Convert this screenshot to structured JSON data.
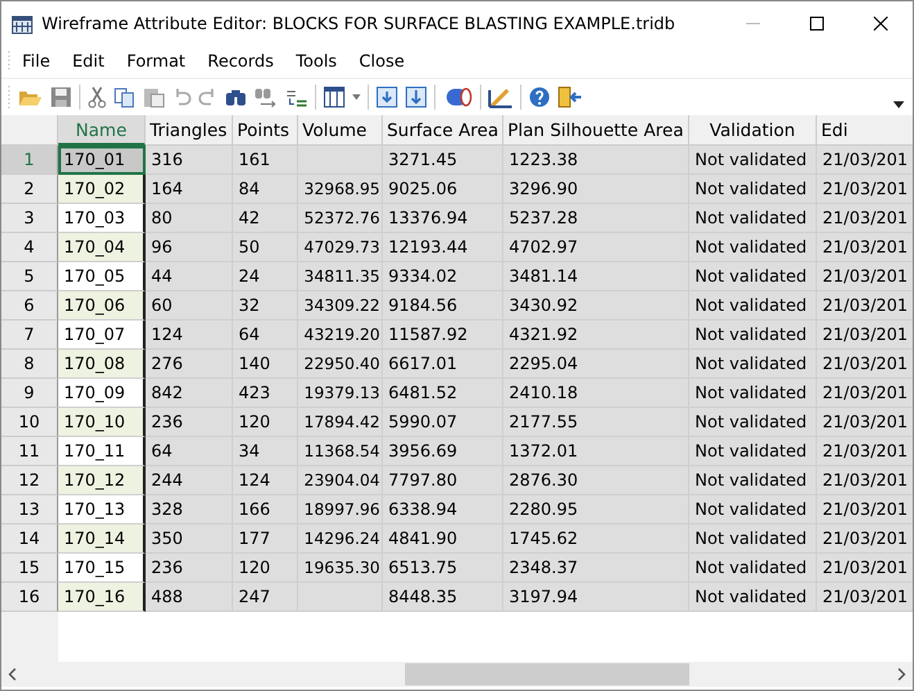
{
  "window": {
    "title": "Wireframe Attribute Editor: BLOCKS FOR SURFACE BLASTING EXAMPLE.tridb"
  },
  "menu": [
    "File",
    "Edit",
    "Format",
    "Records",
    "Tools",
    "Close"
  ],
  "table": {
    "columns": [
      {
        "label": "Name",
        "selected": true
      },
      {
        "label": "Triangles",
        "selected": false
      },
      {
        "label": "Points",
        "selected": false
      },
      {
        "label": "Volume",
        "selected": false
      },
      {
        "label": "Surface Area",
        "selected": false
      },
      {
        "label": "Plan Silhouette Area",
        "selected": false
      },
      {
        "label": "Validation",
        "selected": false
      },
      {
        "label": "Edi",
        "selected": false
      }
    ],
    "rows": [
      {
        "number": "1",
        "selected": true,
        "cells": [
          "170_01",
          "316",
          "161",
          "",
          "3271.45",
          "1223.38",
          "Not validated",
          "21/03/201"
        ]
      },
      {
        "number": "2",
        "selected": false,
        "cells": [
          "170_02",
          "164",
          "84",
          "32968.95",
          "9025.06",
          "3296.90",
          "Not validated",
          "21/03/201"
        ]
      },
      {
        "number": "3",
        "selected": false,
        "cells": [
          "170_03",
          "80",
          "42",
          "52372.76",
          "13376.94",
          "5237.28",
          "Not validated",
          "21/03/201"
        ]
      },
      {
        "number": "4",
        "selected": false,
        "cells": [
          "170_04",
          "96",
          "50",
          "47029.73",
          "12193.44",
          "4702.97",
          "Not validated",
          "21/03/201"
        ]
      },
      {
        "number": "5",
        "selected": false,
        "cells": [
          "170_05",
          "44",
          "24",
          "34811.35",
          "9334.02",
          "3481.14",
          "Not validated",
          "21/03/201"
        ]
      },
      {
        "number": "6",
        "selected": false,
        "cells": [
          "170_06",
          "60",
          "32",
          "34309.22",
          "9184.56",
          "3430.92",
          "Not validated",
          "21/03/201"
        ]
      },
      {
        "number": "7",
        "selected": false,
        "cells": [
          "170_07",
          "124",
          "64",
          "43219.20",
          "11587.92",
          "4321.92",
          "Not validated",
          "21/03/201"
        ]
      },
      {
        "number": "8",
        "selected": false,
        "cells": [
          "170_08",
          "276",
          "140",
          "22950.40",
          "6617.01",
          "2295.04",
          "Not validated",
          "21/03/201"
        ]
      },
      {
        "number": "9",
        "selected": false,
        "cells": [
          "170_09",
          "842",
          "423",
          "19379.13",
          "6481.52",
          "2410.18",
          "Not validated",
          "21/03/201"
        ]
      },
      {
        "number": "10",
        "selected": false,
        "cells": [
          "170_10",
          "236",
          "120",
          "17894.42",
          "5990.07",
          "2177.55",
          "Not validated",
          "21/03/201"
        ]
      },
      {
        "number": "11",
        "selected": false,
        "cells": [
          "170_11",
          "64",
          "34",
          "11368.54",
          "3956.69",
          "1372.01",
          "Not validated",
          "21/03/201"
        ]
      },
      {
        "number": "12",
        "selected": false,
        "cells": [
          "170_12",
          "244",
          "124",
          "23904.04",
          "7797.80",
          "2876.30",
          "Not validated",
          "21/03/201"
        ]
      },
      {
        "number": "13",
        "selected": false,
        "cells": [
          "170_13",
          "328",
          "166",
          "18997.96",
          "6338.94",
          "2280.95",
          "Not validated",
          "21/03/201"
        ]
      },
      {
        "number": "14",
        "selected": false,
        "cells": [
          "170_14",
          "350",
          "177",
          "14296.24",
          "4841.90",
          "1745.62",
          "Not validated",
          "21/03/201"
        ]
      },
      {
        "number": "15",
        "selected": false,
        "cells": [
          "170_15",
          "236",
          "120",
          "19635.30",
          "6513.75",
          "2348.37",
          "Not validated",
          "21/03/201"
        ]
      },
      {
        "number": "16",
        "selected": false,
        "cells": [
          "170_16",
          "488",
          "247",
          "",
          "8448.35",
          "3197.94",
          "Not validated",
          "21/03/201"
        ]
      }
    ]
  }
}
